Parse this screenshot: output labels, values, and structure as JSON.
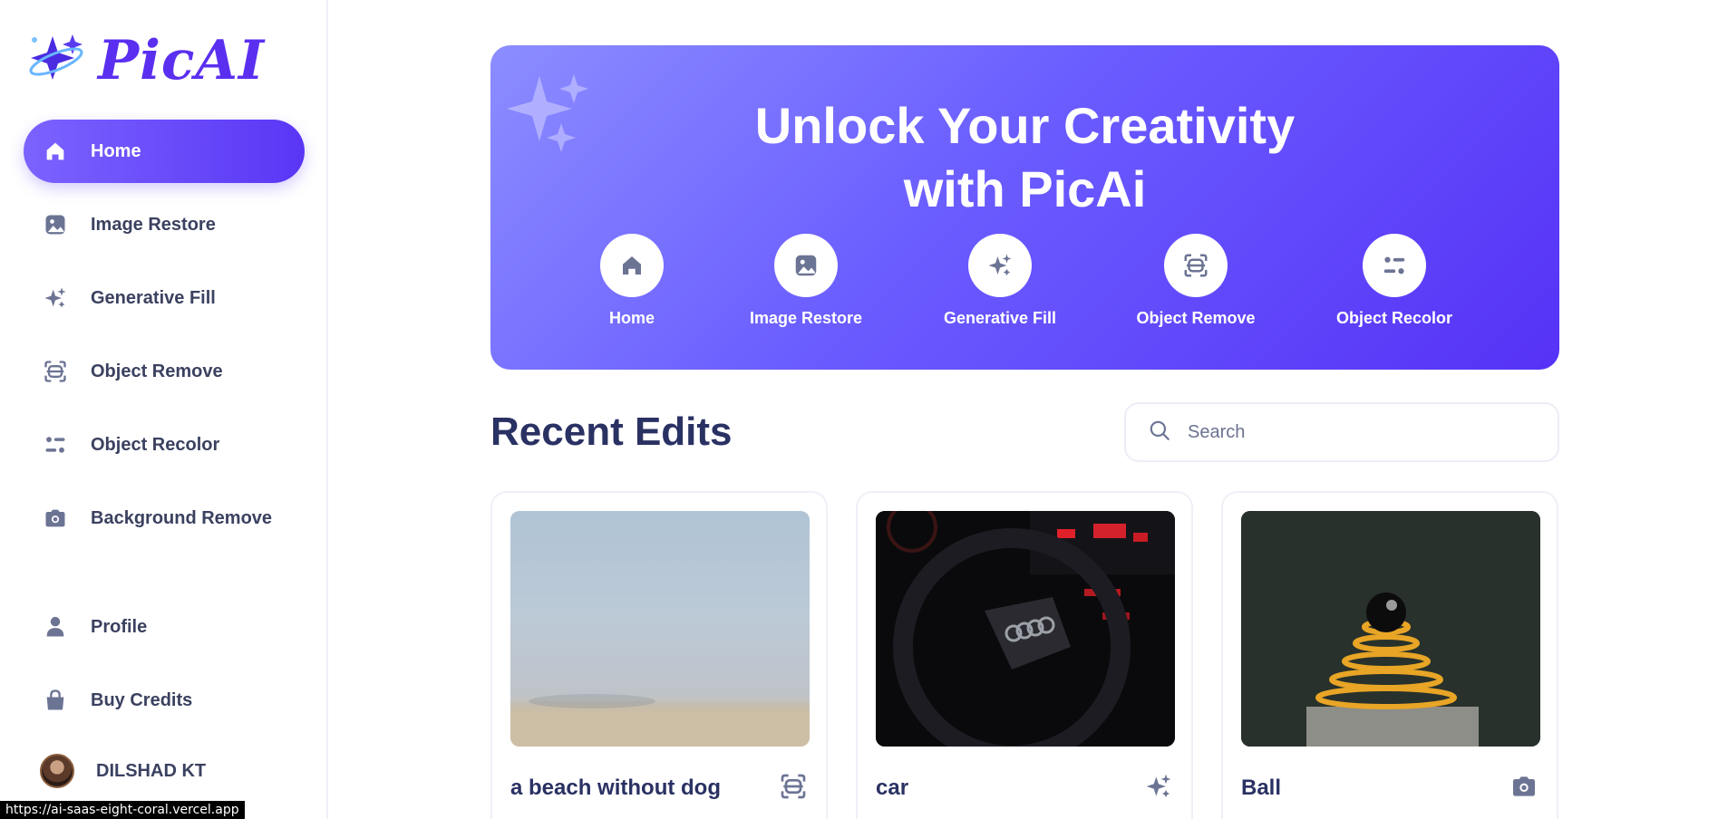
{
  "brand": {
    "name": "PicAI"
  },
  "sidebar": {
    "items": [
      {
        "label": "Home",
        "icon": "home-icon",
        "active": true
      },
      {
        "label": "Image Restore",
        "icon": "image-icon"
      },
      {
        "label": "Generative Fill",
        "icon": "sparkles-icon"
      },
      {
        "label": "Object Remove",
        "icon": "scan-icon"
      },
      {
        "label": "Object Recolor",
        "icon": "filter-icon"
      },
      {
        "label": "Background Remove",
        "icon": "camera-icon"
      },
      {
        "label": "Profile",
        "icon": "user-icon"
      },
      {
        "label": "Buy Credits",
        "icon": "bag-icon"
      }
    ],
    "user": {
      "name": "DILSHAD KT"
    }
  },
  "hero": {
    "title_line1": "Unlock Your Creativity",
    "title_line2": "with PicAi",
    "tools": [
      {
        "label": "Home",
        "icon": "home-icon"
      },
      {
        "label": "Image Restore",
        "icon": "image-icon"
      },
      {
        "label": "Generative Fill",
        "icon": "sparkles-icon"
      },
      {
        "label": "Object Remove",
        "icon": "scan-icon"
      },
      {
        "label": "Object Recolor",
        "icon": "filter-icon"
      }
    ]
  },
  "recent": {
    "title": "Recent Edits",
    "search_placeholder": "Search",
    "cards": [
      {
        "title": "a beach without dog",
        "icon": "scan-icon"
      },
      {
        "title": "car",
        "icon": "sparkles-icon"
      },
      {
        "title": "Ball",
        "icon": "camera-icon"
      }
    ]
  },
  "status_bar": {
    "url": "https://ai-saas-eight-coral.vercel.app"
  },
  "colors": {
    "accent": "#5a36f5",
    "text_dark": "#2a3163",
    "text_nav": "#3b4160",
    "icon_gray": "#6c7494"
  }
}
